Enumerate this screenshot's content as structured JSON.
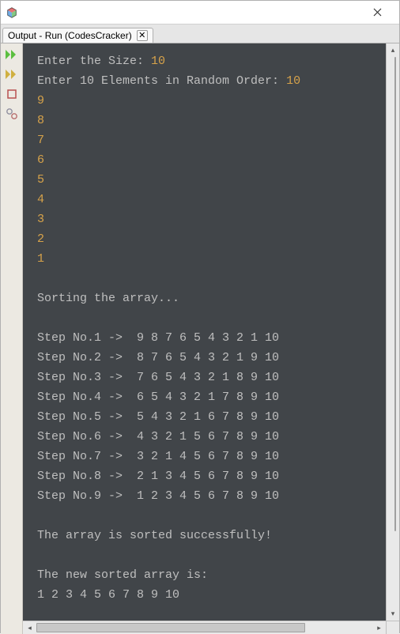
{
  "window": {
    "close_tooltip": "Close"
  },
  "tab": {
    "label": "Output - Run (CodesCracker)"
  },
  "console": {
    "prompt_size": "Enter the Size: ",
    "size_value": "10",
    "prompt_elements": "Enter 10 Elements in Random Order: ",
    "first_element": "10",
    "inputs": [
      "9",
      "8",
      "7",
      "6",
      "5",
      "4",
      "3",
      "2",
      "1"
    ],
    "sorting_msg": "Sorting the array...",
    "steps": [
      "Step No.1 ->  9 8 7 6 5 4 3 2 1 10",
      "Step No.2 ->  8 7 6 5 4 3 2 1 9 10",
      "Step No.3 ->  7 6 5 4 3 2 1 8 9 10",
      "Step No.4 ->  6 5 4 3 2 1 7 8 9 10",
      "Step No.5 ->  5 4 3 2 1 6 7 8 9 10",
      "Step No.6 ->  4 3 2 1 5 6 7 8 9 10",
      "Step No.7 ->  3 2 1 4 5 6 7 8 9 10",
      "Step No.8 ->  2 1 3 4 5 6 7 8 9 10",
      "Step No.9 ->  1 2 3 4 5 6 7 8 9 10"
    ],
    "success_msg": "The array is sorted successfully!",
    "result_label": "The new sorted array is:",
    "result_values": "1 2 3 4 5 6 7 8 9 10"
  },
  "colors": {
    "console_bg": "#414549",
    "console_fg": "#bfbfbf",
    "highlight": "#d6a24a"
  }
}
